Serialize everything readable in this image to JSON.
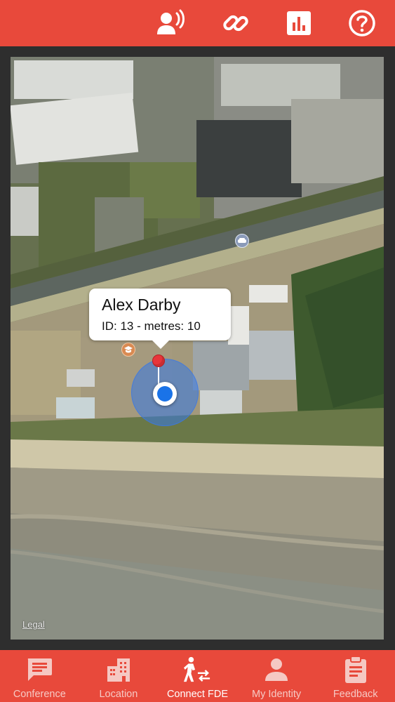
{
  "topbar": {
    "buttons": [
      {
        "icon": "announce-person-icon"
      },
      {
        "icon": "link-icon"
      },
      {
        "icon": "bar-chart-icon"
      },
      {
        "icon": "help-circle-icon"
      }
    ],
    "background": "#e8493b"
  },
  "map": {
    "callout": {
      "title": "Alex Darby",
      "subtitle": "ID: 13 - metres: 10"
    },
    "legal_label": "Legal",
    "accuracy_color": "#3478e6",
    "pin_color": "#e8353a",
    "user_dot_color": "#1a73e8"
  },
  "tabbar": {
    "tabs": [
      {
        "label": "Conference",
        "icon": "chat-bubble-icon",
        "active": false
      },
      {
        "label": "Location",
        "icon": "building-icon",
        "active": false
      },
      {
        "label": "Connect FDE",
        "icon": "person-transfer-icon",
        "active": true
      },
      {
        "label": "My Identity",
        "icon": "person-icon",
        "active": false
      },
      {
        "label": "Feedback",
        "icon": "clipboard-icon",
        "active": false
      }
    ],
    "active_label_color": "#ffffff",
    "inactive_label_color": "#f6c9c4"
  }
}
